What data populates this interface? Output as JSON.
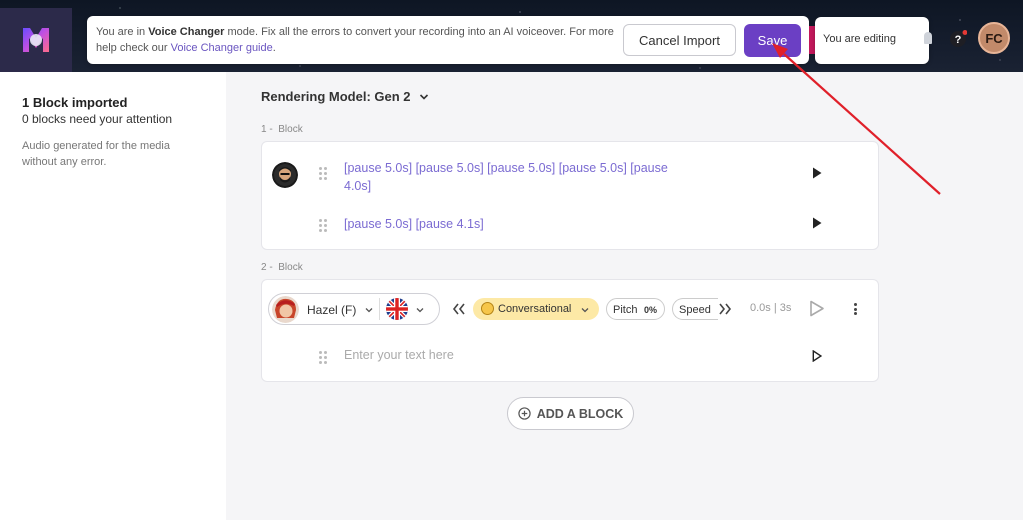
{
  "banner": {
    "text_prefix": "You are in ",
    "mode_name": "Voice Changer",
    "text_middle": " mode. Fix all the errors to convert your recording into an AI voiceover. For more help check our ",
    "guide_link": "Voice Changer guide",
    "text_suffix": ".",
    "cancel_label": "Cancel Import",
    "save_label": "Save"
  },
  "header": {
    "editing_label": "You are editing",
    "user_initials": "FC"
  },
  "sidebar": {
    "title": "1 Block imported",
    "subtitle": "0 blocks need your attention",
    "description": "Audio generated for the media without any error."
  },
  "main": {
    "rendering_model": "Rendering Model: Gen 2",
    "blocks": [
      {
        "number": "1 -",
        "label": "Block",
        "lines": [
          "[pause 5.0s] [pause 5.0s] [pause 5.0s] [pause 5.0s] [pause 4.0s]",
          "[pause 5.0s] [pause 4.1s]"
        ]
      },
      {
        "number": "2 -",
        "label": "Block",
        "voice": "Hazel (F)",
        "style": "Conversational",
        "pitch_label": "Pitch",
        "pitch_value": "0%",
        "speed_label": "Speed",
        "time": "0.0s | 3s",
        "placeholder": "Enter your text here"
      }
    ],
    "add_block_label": "ADD A BLOCK"
  },
  "colors": {
    "accent": "#6b3fc4",
    "pause_text": "#7b6bd2",
    "annotation_arrow": "#e0202a"
  }
}
